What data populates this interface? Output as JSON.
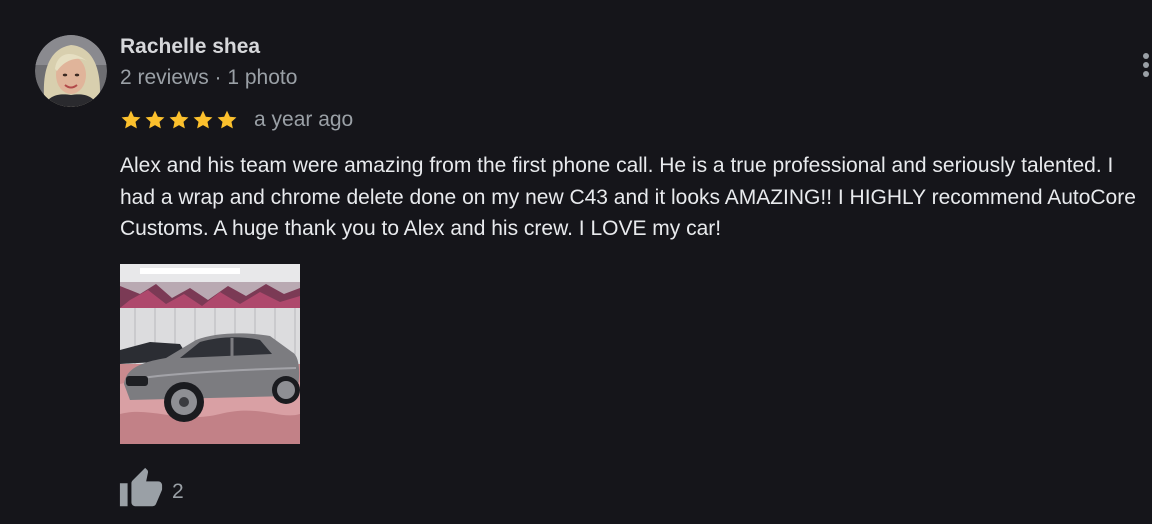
{
  "reviewer": {
    "name": "Rachelle shea",
    "meta": "2 reviews · 1 photo"
  },
  "review": {
    "rating": 5,
    "rating_max": 5,
    "time": "a year ago",
    "text": "Alex and his team were amazing from the first phone call. He is a true professional and seriously talented. I had a wrap and chrome delete done on my new C43 and it looks AMAZING!! I HIGHLY recommend AutoCore Customs. A huge thank you to Alex and his crew. I LOVE my car!",
    "photo_icon": "car-photo",
    "likes": "2"
  },
  "icons": {
    "more": "more-vert-icon",
    "star": "star-icon",
    "like": "thumb-up-icon"
  },
  "colors": {
    "background": "#15151a",
    "star": "#fbc02d",
    "name": "#d6d7da",
    "secondary_text": "#9aa0a6",
    "body_text": "#e8eaed"
  }
}
